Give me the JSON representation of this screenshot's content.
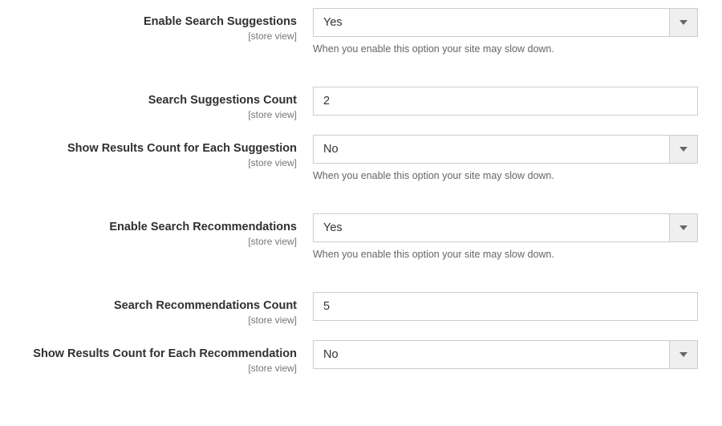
{
  "scope_label": "[store view]",
  "help_slowdown": "When you enable this option your site may slow down.",
  "fields": {
    "enable_search_suggestions": {
      "label": "Enable Search Suggestions",
      "value": "Yes"
    },
    "search_suggestions_count": {
      "label": "Search Suggestions Count",
      "value": "2"
    },
    "show_results_count_suggestion": {
      "label": "Show Results Count for Each Suggestion",
      "value": "No"
    },
    "enable_search_recommendations": {
      "label": "Enable Search Recommendations",
      "value": "Yes"
    },
    "search_recommendations_count": {
      "label": "Search Recommendations Count",
      "value": "5"
    },
    "show_results_count_recommendation": {
      "label": "Show Results Count for Each Recommendation",
      "value": "No"
    }
  }
}
